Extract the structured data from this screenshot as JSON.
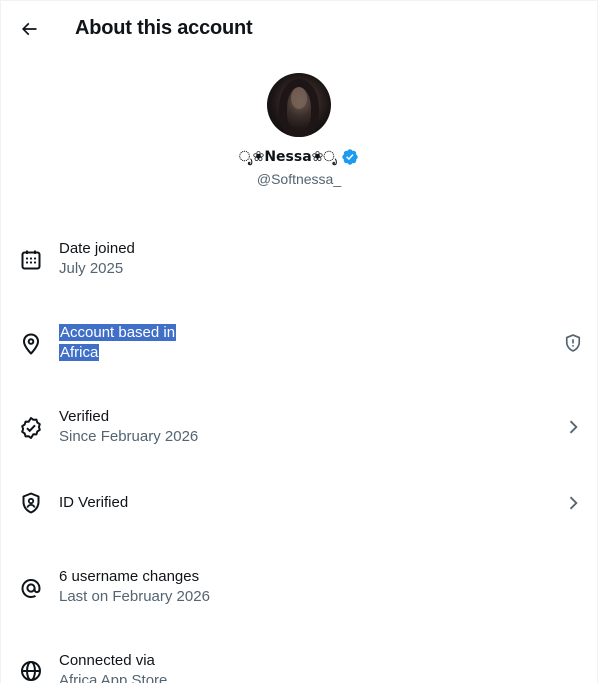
{
  "header": {
    "title": "About this account"
  },
  "profile": {
    "display_name": "ೃ❀Nessa❀ೃ",
    "handle": "@Softnessa_",
    "verified_color": "#1d9bf0"
  },
  "rows": [
    {
      "icon": "calendar-icon",
      "primary": "Date joined",
      "secondary": "July 2025"
    },
    {
      "icon": "location-pin-icon",
      "primary": "Account based in",
      "secondary": "Africa",
      "trail_icon": "shield-alert-icon"
    },
    {
      "icon": "verified-check-icon",
      "primary": "Verified",
      "secondary": "Since February 2026",
      "trail_icon": "chevron-right-icon"
    },
    {
      "icon": "id-shield-icon",
      "primary": "ID Verified",
      "trail_icon": "chevron-right-icon"
    },
    {
      "icon": "at-sign-icon",
      "primary": "6 username changes",
      "secondary": "Last on February 2026"
    },
    {
      "icon": "globe-icon",
      "primary": "Connected via",
      "secondary": "Africa App Store"
    }
  ],
  "colors": {
    "text_primary": "#0f1419",
    "text_secondary": "#536471",
    "selection": "#3f6fc7"
  }
}
